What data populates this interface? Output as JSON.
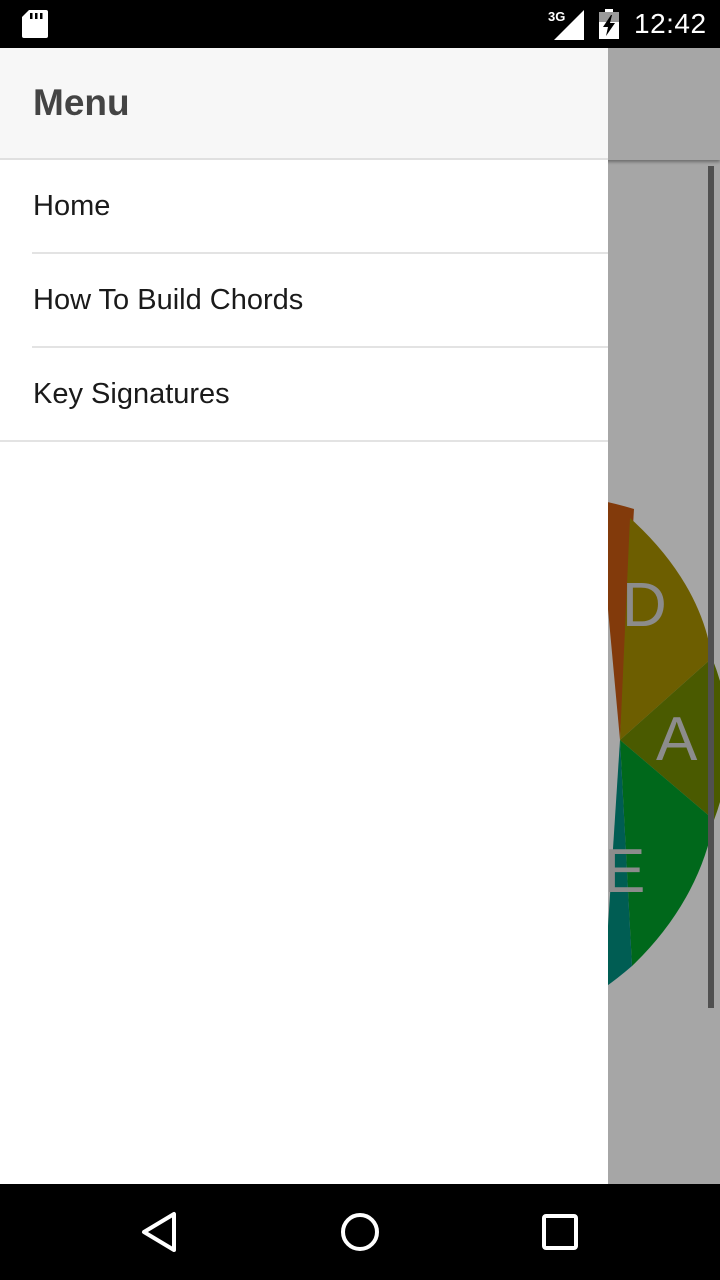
{
  "status_bar": {
    "time": "12:42",
    "network": "3G",
    "icons": [
      "sd-card-icon",
      "signal-icon",
      "battery-charging-icon"
    ]
  },
  "drawer": {
    "title": "Menu",
    "items": [
      {
        "label": "Home"
      },
      {
        "label": "How To Build Chords"
      },
      {
        "label": "Key Signatures"
      }
    ]
  },
  "background": {
    "wheel_labels": [
      "D",
      "A",
      "E"
    ],
    "colors": {
      "orange": "#c85a12",
      "gold": "#a89100",
      "olive": "#728a00",
      "green": "#00a02a",
      "teal": "#008f80",
      "scrim": "rgba(0,0,0,0.35)"
    }
  },
  "nav_bar": {
    "icons": [
      "back-icon",
      "home-icon",
      "recents-icon"
    ]
  }
}
